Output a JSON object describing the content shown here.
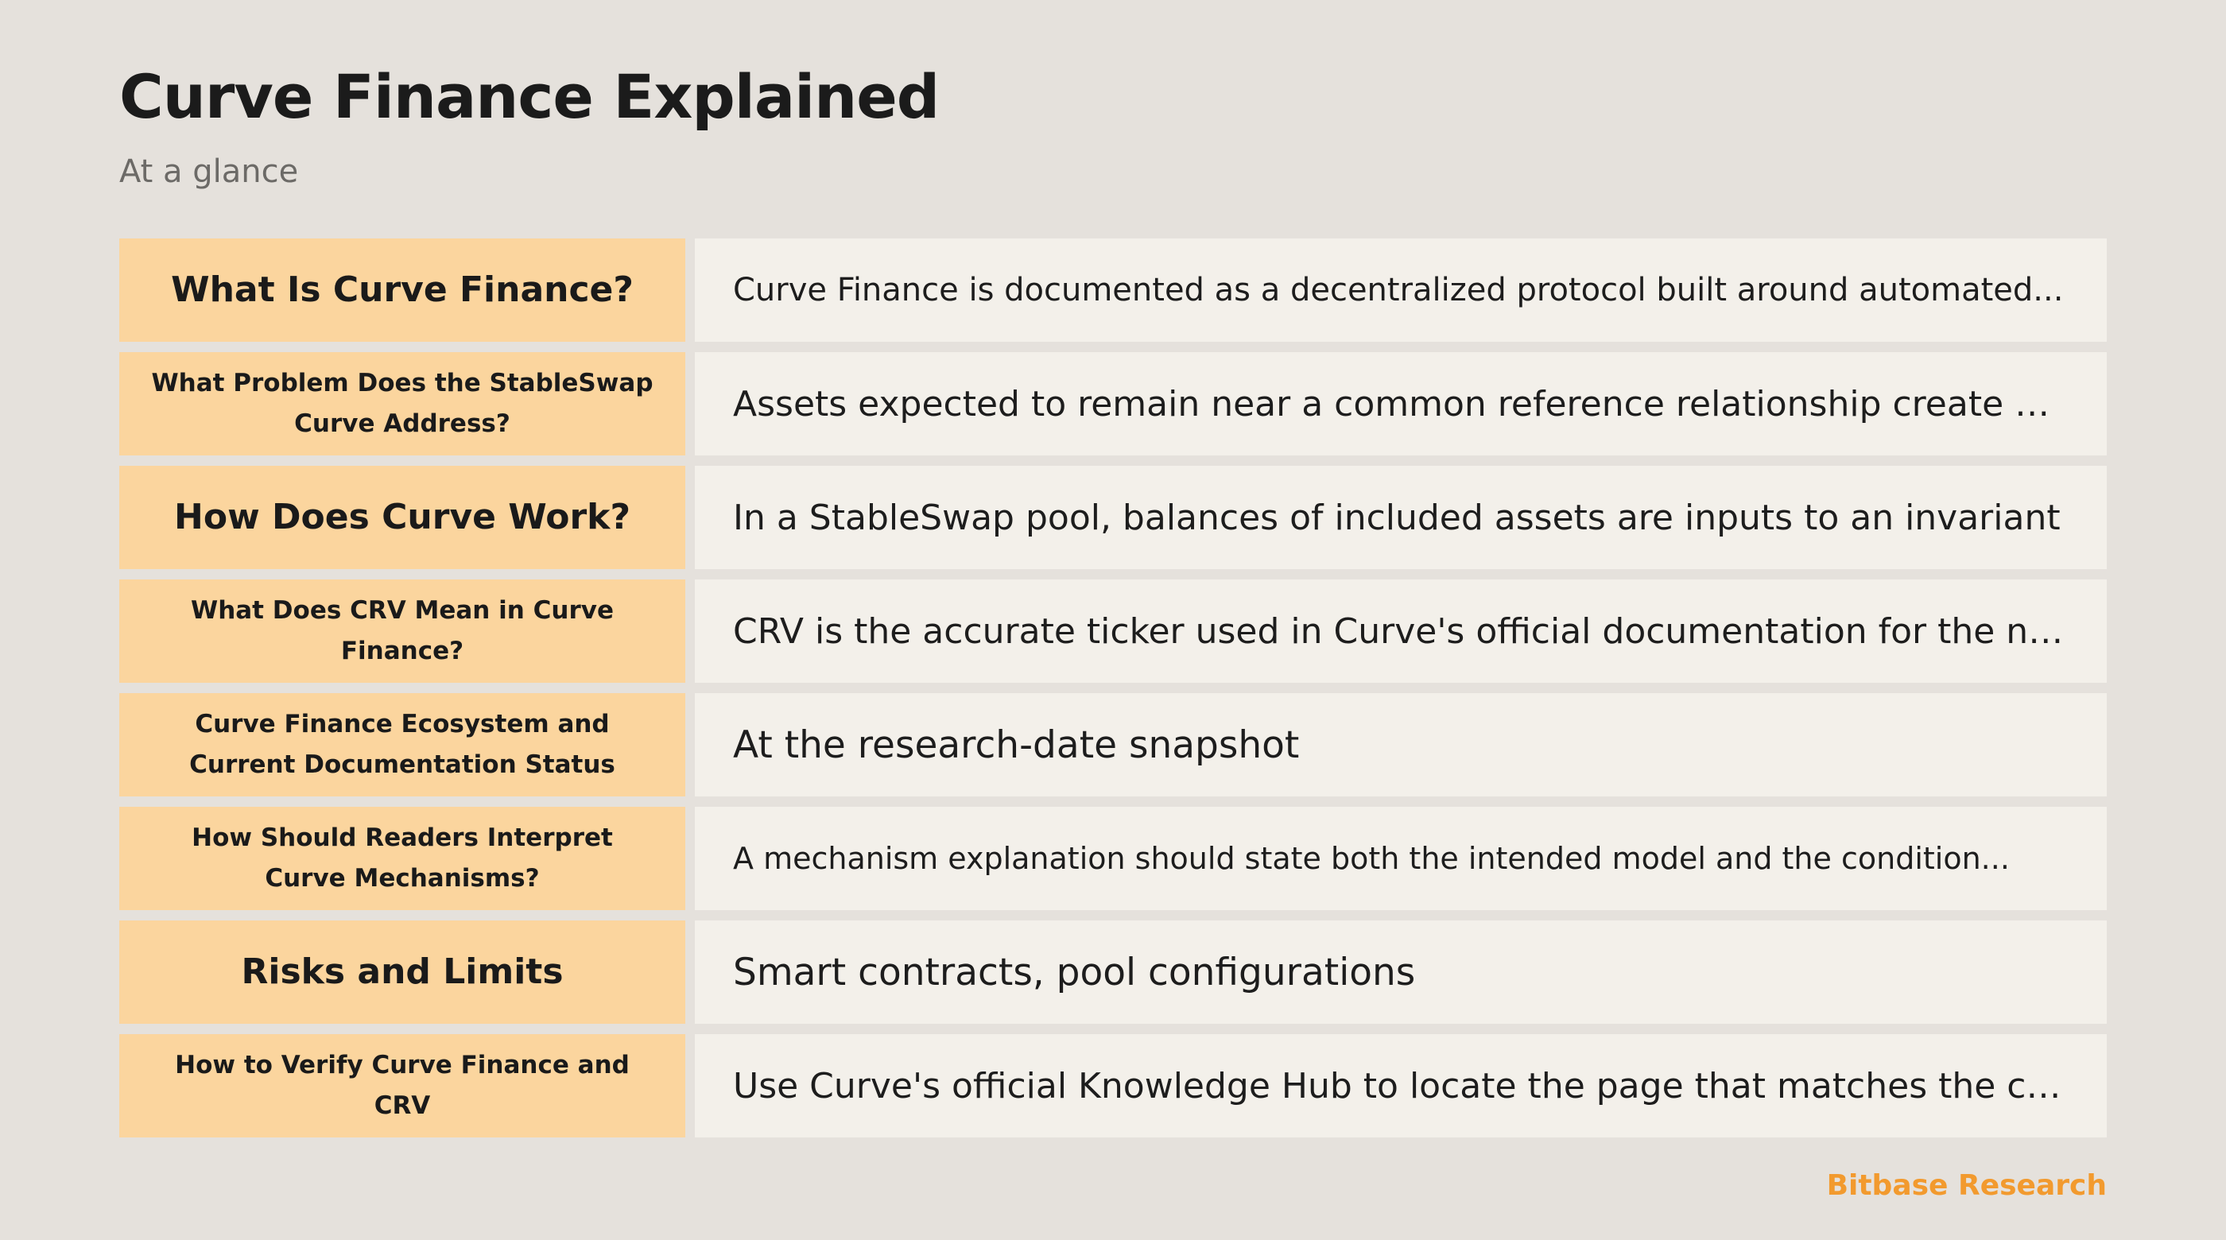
{
  "header": {
    "title": "Curve Finance Explained",
    "subtitle": "At a glance"
  },
  "rows": [
    {
      "label": "What Is Curve Finance?",
      "value": "Curve Finance is documented as a decentralized protocol built around automated..."
    },
    {
      "label": "What Problem Does the StableSwap Curve Address?",
      "value": "Assets expected to remain near a common reference relationship create a..."
    },
    {
      "label": "How Does Curve Work?",
      "value": "In a StableSwap pool, balances of included assets are inputs to an invariant"
    },
    {
      "label": "What Does CRV Mean in Curve Finance?",
      "value": "CRV is the accurate ticker used in Curve's official documentation for the native..."
    },
    {
      "label": "Curve Finance Ecosystem and Current Documentation Status",
      "value": "At the research-date snapshot"
    },
    {
      "label": "How Should Readers Interpret Curve Mechanisms?",
      "value": "A mechanism explanation should state both the intended model and the condition..."
    },
    {
      "label": "Risks and Limits",
      "value": "Smart contracts, pool configurations"
    },
    {
      "label": "How to Verify Curve Finance and CRV",
      "value": "Use Curve's official Knowledge Hub to locate the page that matches the claim..."
    }
  ],
  "footer": {
    "brand": "Bitbase Research"
  },
  "colors": {
    "background": "#e5e1dc",
    "label_fill": "#fbd59e",
    "value_fill": "#f3f0ea",
    "brand_accent": "#f29a2e"
  }
}
